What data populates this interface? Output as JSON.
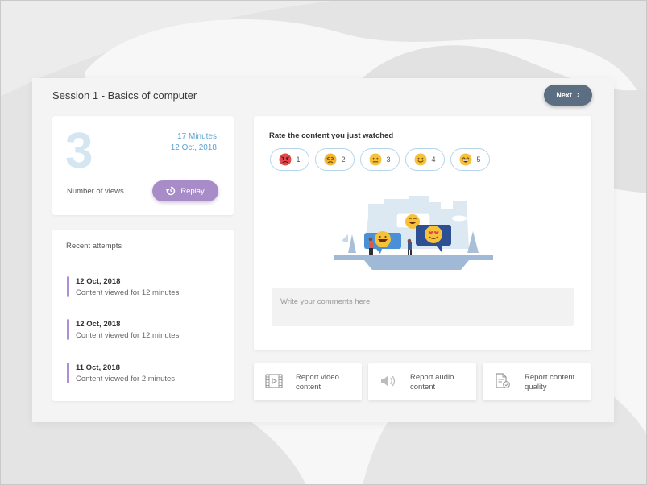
{
  "session": {
    "title": "Session 1 - Basics of computer",
    "next_label": "Next"
  },
  "views": {
    "count": "3",
    "duration": "17 Minutes",
    "date": "12 Oct, 2018",
    "label": "Number of views",
    "replay_label": "Replay"
  },
  "attempts": {
    "header": "Recent attempts",
    "items": [
      {
        "date": "12 Oct, 2018",
        "desc": "Content viewed for 12 minutes"
      },
      {
        "date": "12 Oct, 2018",
        "desc": "Content viewed for 12 minutes"
      },
      {
        "date": "11 Oct, 2018",
        "desc": "Content viewed for 2 minutes"
      }
    ]
  },
  "rating": {
    "title": "Rate the content you just watched",
    "options": [
      {
        "value": "1",
        "icon": "angry-face-icon"
      },
      {
        "value": "2",
        "icon": "sad-face-icon"
      },
      {
        "value": "3",
        "icon": "neutral-face-icon"
      },
      {
        "value": "4",
        "icon": "slight-smile-face-icon"
      },
      {
        "value": "5",
        "icon": "grin-face-icon"
      }
    ]
  },
  "comments": {
    "placeholder": "Write your comments here"
  },
  "reports": {
    "video": {
      "label": "Report video content",
      "icon": "film-icon"
    },
    "audio": {
      "label": "Report audio content",
      "icon": "speaker-icon"
    },
    "quality": {
      "label": "Report content quality",
      "icon": "document-check-icon"
    }
  },
  "colors": {
    "accent_purple": "#a78cc8",
    "next_button": "#5b6e82",
    "views_number": "#d3e6f1",
    "meta_blue": "#5aa3d2",
    "rating_border": "#b5d5ea"
  }
}
